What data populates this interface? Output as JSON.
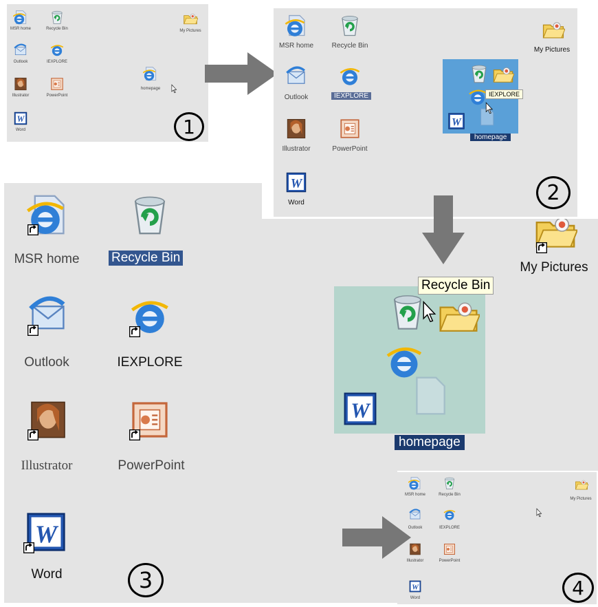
{
  "steps": [
    "1",
    "2",
    "3",
    "4"
  ],
  "icons": {
    "msr_home": "MSR home",
    "recycle_bin": "Recycle Bin",
    "my_pictures": "My Pictures",
    "outlook": "Outlook",
    "iexplore": "IEXPLORE",
    "illustrator": "Illustrator",
    "powerpoint": "PowerPoint",
    "word": "Word",
    "homepage": "homepage"
  },
  "tooltips": {
    "iexplore": "IEXPLORE",
    "recycle_bin": "Recycle Bin"
  },
  "colors": {
    "desktop": "#e4e4e4",
    "selection": "#33568f",
    "stack_highlight_blue": "#5aa0d8",
    "stack_highlight_teal": "#b5d5cc",
    "arrow": "#777777"
  }
}
